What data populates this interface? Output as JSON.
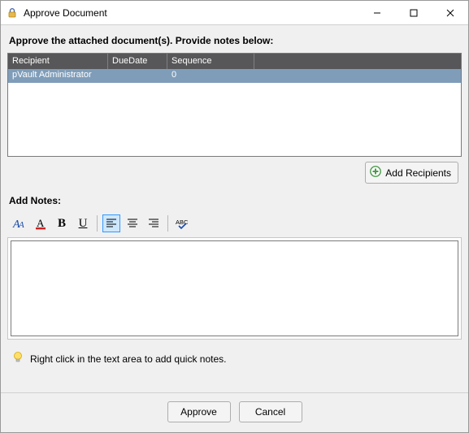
{
  "window": {
    "title": "Approve Document"
  },
  "instruction": "Approve the attached document(s). Provide notes below:",
  "grid": {
    "headers": {
      "recipient": "Recipient",
      "dueDate": "DueDate",
      "sequence": "Sequence"
    },
    "rows": [
      {
        "recipient": "pVault Administrator",
        "dueDate": "",
        "sequence": "0"
      }
    ]
  },
  "addRecipients": "Add Recipients",
  "notesLabel": "Add Notes:",
  "notesValue": "",
  "hint": "Right click in the text area to add quick notes.",
  "buttons": {
    "approve": "Approve",
    "cancel": "Cancel"
  }
}
